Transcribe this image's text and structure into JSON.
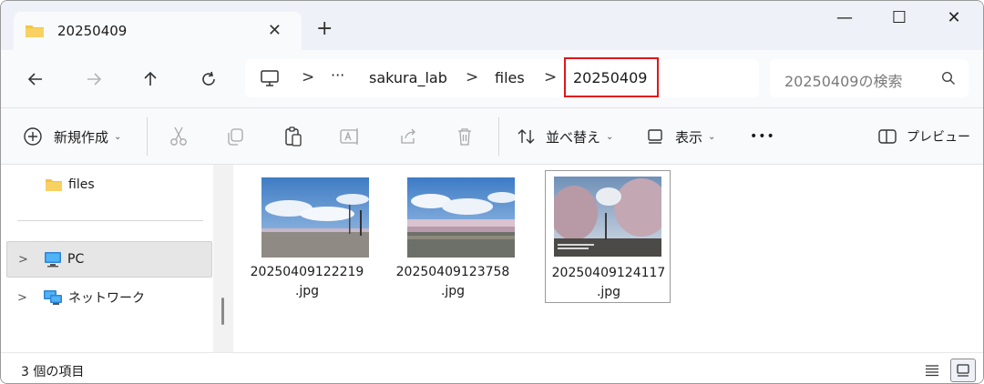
{
  "tab": {
    "title": "20250409",
    "icon": "folder-icon",
    "close": "✕",
    "new_tab": "+"
  },
  "window_controls": {
    "minimize": "—",
    "maximize": "☐",
    "close": "✕"
  },
  "nav": {
    "back": "←",
    "forward": "→",
    "up": "↑",
    "refresh": "⟳"
  },
  "breadcrumb": {
    "more": "···",
    "items": [
      "sakura_lab",
      "files",
      "20250409"
    ],
    "separator": ">"
  },
  "search": {
    "placeholder": "20250409の検索"
  },
  "toolbar": {
    "new_label": "新規作成",
    "sort_label": "並べ替え",
    "view_label": "表示",
    "more_label": "•••",
    "preview_label": "プレビュー"
  },
  "sidebar": {
    "folder_label": "files",
    "items": [
      {
        "label": "PC",
        "icon": "pc-icon",
        "expand": ">"
      },
      {
        "label": "ネットワーク",
        "icon": "network-icon",
        "expand": ">"
      }
    ]
  },
  "files": [
    {
      "name_line1": "20250409122219",
      "name_line2": ".jpg"
    },
    {
      "name_line1": "20250409123758",
      "name_line2": ".jpg"
    },
    {
      "name_line1": "20250409124117",
      "name_line2": ".jpg"
    }
  ],
  "status": {
    "count_text": "3 個の項目"
  },
  "colors": {
    "highlight": "#e0161b",
    "folder": "#f4c542",
    "sky": "#4d86c8"
  }
}
